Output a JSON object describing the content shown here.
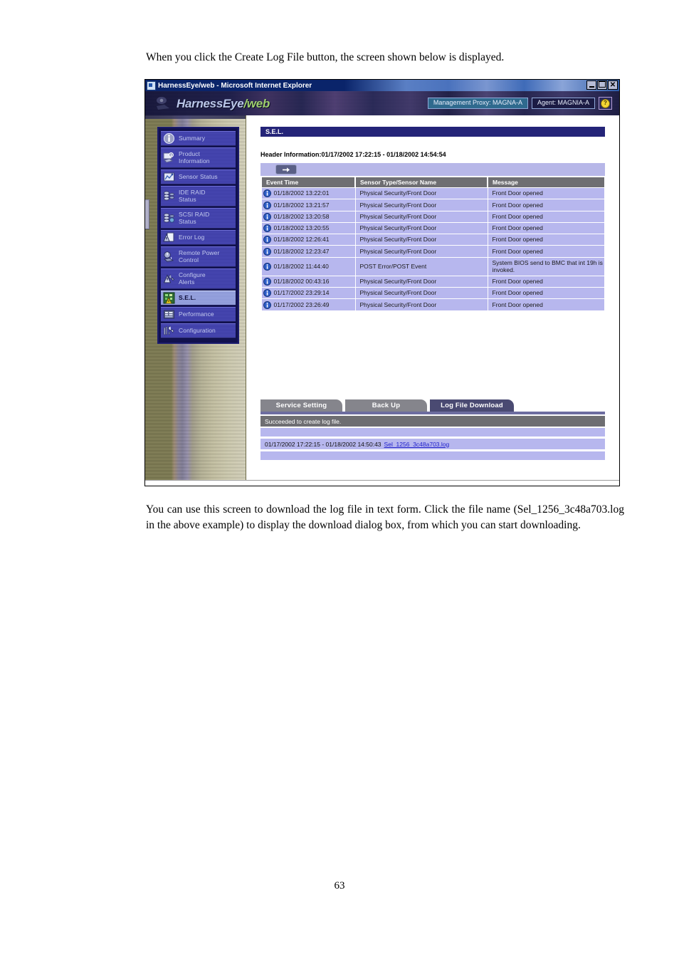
{
  "document": {
    "intro_paragraph": "When you click the Create Log File button, the screen shown below is displayed.",
    "outro_paragraph": "You can use this screen to download the log file in text form.   Click the file name (Sel_1256_3c48a703.log in the above example) to display the download dialog box, from which you can start downloading.",
    "page_number": "63"
  },
  "window": {
    "title": "HarnessEye/web - Microsoft Internet Explorer",
    "minimize_label": "",
    "maximize_label": "",
    "close_label": "✕"
  },
  "brand": {
    "name_main": "HarnessEye",
    "name_suffix": "/web"
  },
  "header": {
    "management_proxy": "Management Proxy: MAGNA-A",
    "agent": "Agent: MAGNIA-A",
    "help_glyph": "?"
  },
  "sidebar": {
    "items": [
      {
        "label": "Summary",
        "icon": "info-circle-icon",
        "active": false
      },
      {
        "label": "Product\nInformation",
        "icon": "product-info-icon",
        "active": false
      },
      {
        "label": "Sensor Status",
        "icon": "sensor-status-icon",
        "active": false
      },
      {
        "label": "IDE RAID\nStatus",
        "icon": "ide-raid-icon",
        "active": false
      },
      {
        "label": "SCSI RAID\nStatus",
        "icon": "scsi-raid-icon",
        "active": false
      },
      {
        "label": "Error Log",
        "icon": "error-log-icon",
        "active": false
      },
      {
        "label": "Remote Power\nControl",
        "icon": "remote-power-icon",
        "active": false
      },
      {
        "label": "Configure\nAlerts",
        "icon": "configure-alerts-icon",
        "active": false
      },
      {
        "label": "S.E.L.",
        "icon": "sel-icon",
        "active": true
      },
      {
        "label": "Performance",
        "icon": "performance-icon",
        "active": false
      },
      {
        "label": "Configuration",
        "icon": "configuration-icon",
        "active": false
      }
    ]
  },
  "main": {
    "section_title": "S.E.L.",
    "header_information": "Header Information:01/17/2002 17:22:15 - 01/18/2002 14:54:54",
    "next_page_button_label": "→"
  },
  "table": {
    "columns": [
      "Event Time",
      "Sensor Type/Sensor Name",
      "Message"
    ],
    "rows": [
      {
        "icon": "info-icon",
        "time": "01/18/2002 13:22:01",
        "sensor": "Physical Security/Front Door",
        "message": "Front Door opened"
      },
      {
        "icon": "info-icon",
        "time": "01/18/2002 13:21:57",
        "sensor": "Physical Security/Front Door",
        "message": "Front Door opened"
      },
      {
        "icon": "info-icon",
        "time": "01/18/2002 13:20:58",
        "sensor": "Physical Security/Front Door",
        "message": "Front Door opened"
      },
      {
        "icon": "info-icon",
        "time": "01/18/2002 13:20:55",
        "sensor": "Physical Security/Front Door",
        "message": "Front Door opened"
      },
      {
        "icon": "info-icon",
        "time": "01/18/2002 12:26:41",
        "sensor": "Physical Security/Front Door",
        "message": "Front Door opened"
      },
      {
        "icon": "info-icon",
        "time": "01/18/2002 12:23:47",
        "sensor": "Physical Security/Front Door",
        "message": "Front Door opened"
      },
      {
        "icon": "info-icon",
        "time": "01/18/2002 11:44:40",
        "sensor": "POST Error/POST Event",
        "message": "System BIOS send to BMC that int 19h is invoked."
      },
      {
        "icon": "info-icon",
        "time": "01/18/2002 00:43:16",
        "sensor": "Physical Security/Front Door",
        "message": "Front Door opened"
      },
      {
        "icon": "info-icon",
        "time": "01/17/2002 23:29:14",
        "sensor": "Physical Security/Front Door",
        "message": "Front Door opened"
      },
      {
        "icon": "info-icon",
        "time": "01/17/2002 23:26:49",
        "sensor": "Physical Security/Front Door",
        "message": "Front Door opened"
      }
    ]
  },
  "tabs": [
    {
      "label": "Service Setting",
      "active": false
    },
    {
      "label": "Back Up",
      "active": false
    },
    {
      "label": "Log File Download",
      "active": true
    }
  ],
  "download": {
    "status_message": "Succeeded to create log file.",
    "file_date_range": "01/17/2002 17:22:15 - 01/18/2002 14:50:43",
    "file_link": "Sel_1256_3c48a703.log"
  },
  "colors": {
    "accent_navy": "#242478",
    "row_lavender": "#b7b7ee",
    "header_gray": "#6e6e72",
    "tab_active": "#4a4a72",
    "link_blue": "#2222cc"
  }
}
